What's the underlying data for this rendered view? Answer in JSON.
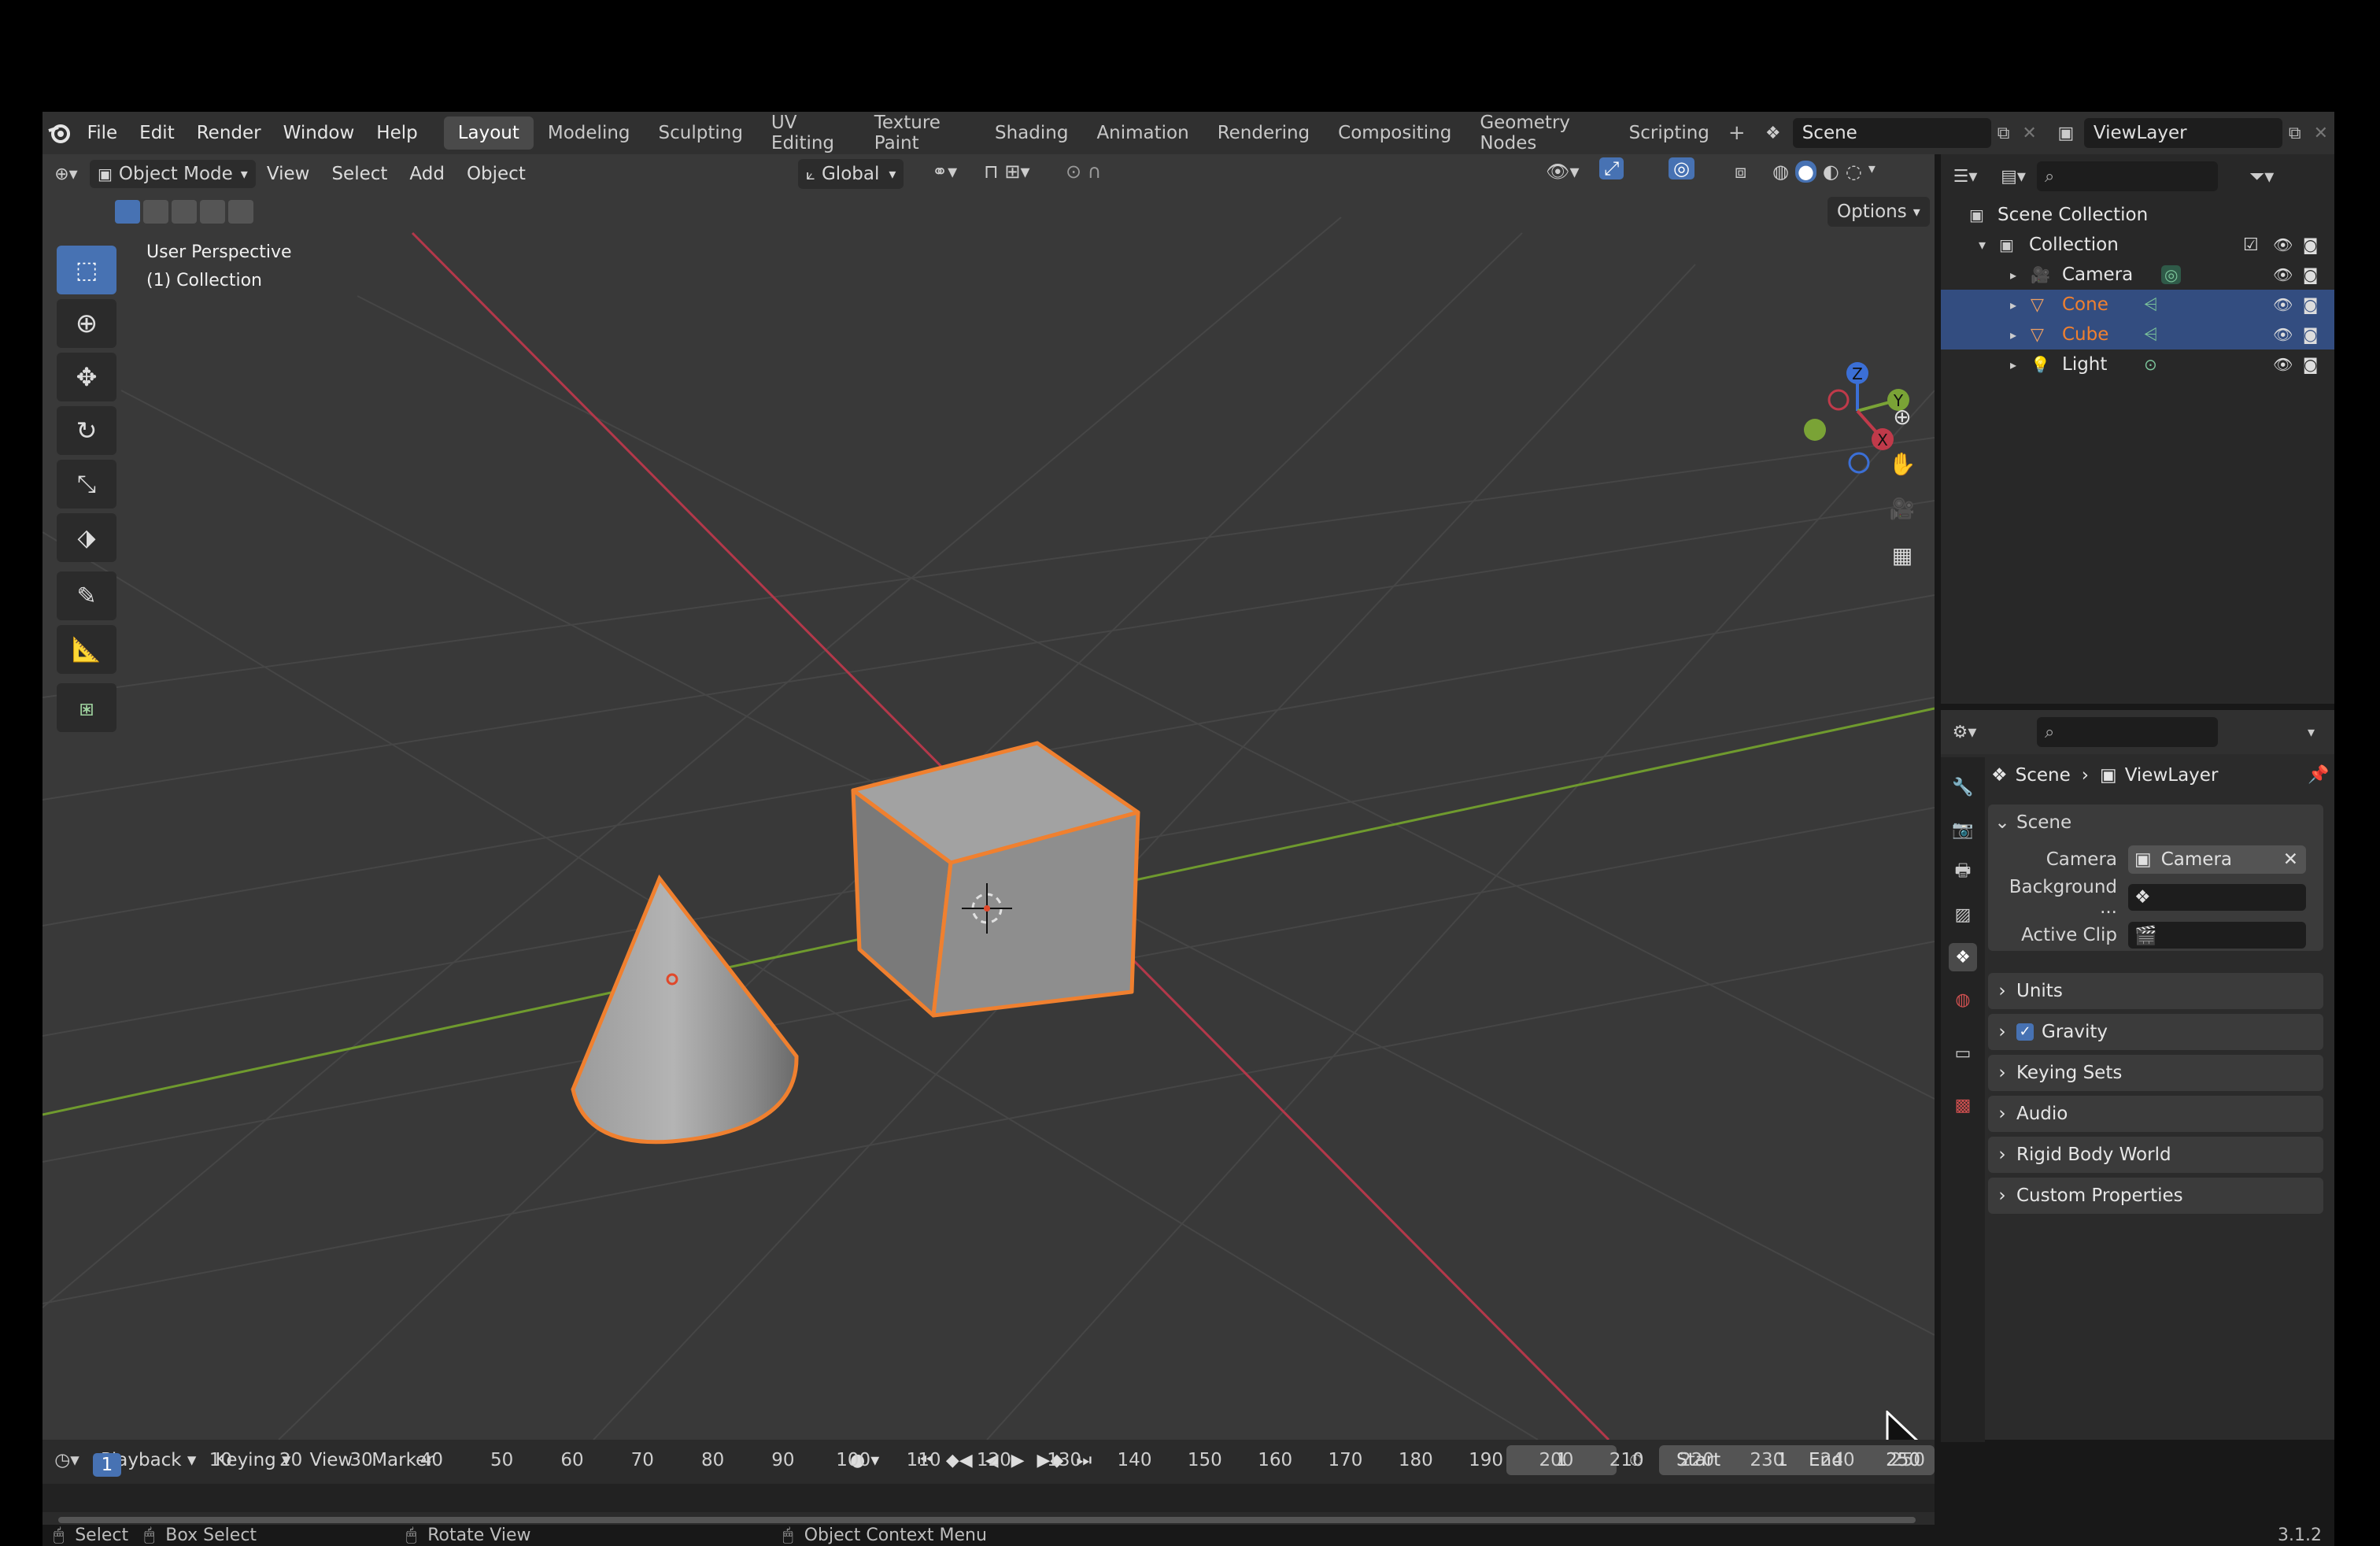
{
  "menus": [
    "File",
    "Edit",
    "Render",
    "Window",
    "Help"
  ],
  "workspaces": [
    "Layout",
    "Modeling",
    "Sculpting",
    "UV Editing",
    "Texture Paint",
    "Shading",
    "Animation",
    "Rendering",
    "Compositing",
    "Geometry Nodes",
    "Scripting"
  ],
  "active_workspace": "Layout",
  "scene_field": "Scene",
  "viewlayer_field": "ViewLayer",
  "viewport": {
    "mode": "Object Mode",
    "menus": [
      "View",
      "Select",
      "Add",
      "Object"
    ],
    "orientation": "Global",
    "options_label": "Options",
    "overlay_title": "User Perspective",
    "overlay_sub": "(1) Collection",
    "gizmo_axes": {
      "z": "Z",
      "y": "Y",
      "x": "X"
    }
  },
  "outliner": {
    "root": "Scene Collection",
    "collection": "Collection",
    "items": [
      {
        "name": "Camera",
        "selected": false,
        "color": "#e6e6e6"
      },
      {
        "name": "Cone",
        "selected": true,
        "color": "#f0802f"
      },
      {
        "name": "Cube",
        "selected": true,
        "color": "#f0802f"
      },
      {
        "name": "Light",
        "selected": false,
        "color": "#e6e6e6"
      }
    ]
  },
  "properties": {
    "breadcrumb_scene": "Scene",
    "breadcrumb_viewlayer": "ViewLayer",
    "section_title": "Scene",
    "camera_label": "Camera",
    "camera_value": "Camera",
    "background_label": "Background ...",
    "active_clip_label": "Active Clip",
    "subsections": [
      "Units",
      "Gravity",
      "Keying Sets",
      "Audio",
      "Rigid Body World",
      "Custom Properties"
    ],
    "gravity_checked": true
  },
  "timeline": {
    "menus": [
      "Playback",
      "Keying",
      "View",
      "Marker"
    ],
    "current_frame": "1",
    "start_label": "Start",
    "start_value": "1",
    "end_label": "End",
    "end_value": "250",
    "ticks": [
      "1",
      "10",
      "20",
      "30",
      "40",
      "50",
      "60",
      "70",
      "80",
      "90",
      "100",
      "110",
      "120",
      "130",
      "140",
      "150",
      "160",
      "170",
      "180",
      "190",
      "200",
      "210",
      "220",
      "230",
      "240",
      "250"
    ]
  },
  "status": {
    "select": "Select",
    "box_select": "Box Select",
    "rotate_view": "Rotate View",
    "context_menu": "Object Context Menu",
    "version": "3.1.2"
  },
  "colors": {
    "accent": "#4772b3",
    "selection_outline": "#f0802f",
    "x_axis": "#c03a4a",
    "y_axis": "#7aa336"
  }
}
